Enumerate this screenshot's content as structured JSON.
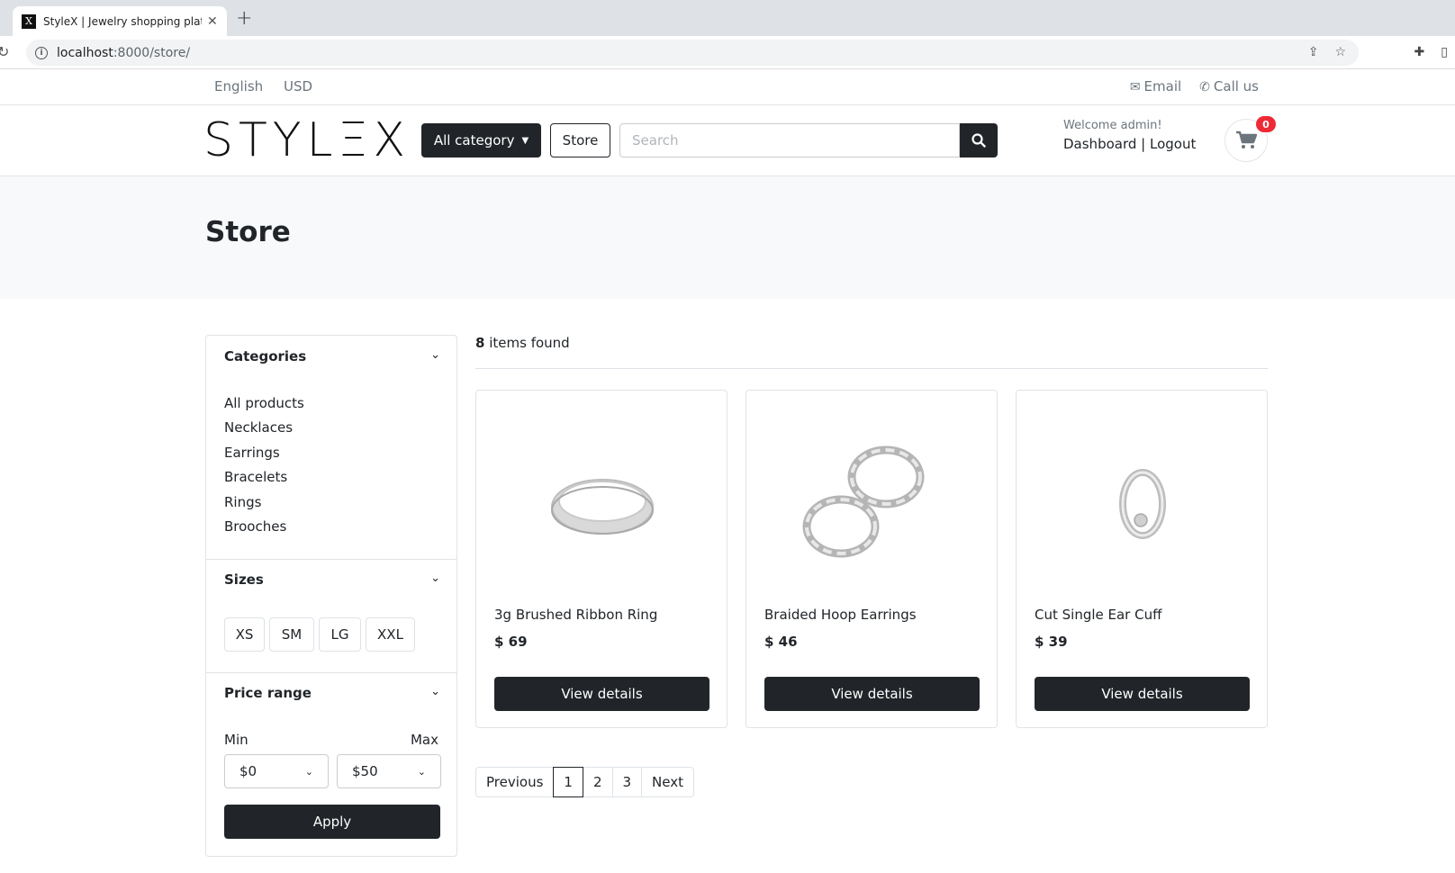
{
  "browser": {
    "tab_title": "StyleX | Jewelry shopping platf",
    "favicon_letter": "X",
    "url_host": "localhost",
    "url_rest": ":8000/store/"
  },
  "topbar": {
    "language": "English",
    "currency": "USD",
    "email_label": "Email",
    "call_label": "Call us"
  },
  "header": {
    "logo_text": "STYLΞX",
    "all_category_label": "All category",
    "store_label": "Store",
    "search_placeholder": "Search",
    "welcome_text": "Welcome admin!",
    "dashboard_label": "Dashboard",
    "separator": "|",
    "logout_label": "Logout",
    "cart_count": "0"
  },
  "page": {
    "title": "Store"
  },
  "sidebar": {
    "categories_heading": "Categories",
    "categories": [
      "All products",
      "Necklaces",
      "Earrings",
      "Bracelets",
      "Rings",
      "Brooches"
    ],
    "sizes_heading": "Sizes",
    "sizes": [
      "XS",
      "SM",
      "LG",
      "XXL"
    ],
    "price_heading": "Price range",
    "min_label": "Min",
    "max_label": "Max",
    "min_value": "$0",
    "max_value": "$50",
    "apply_label": "Apply"
  },
  "results": {
    "count": "8",
    "count_suffix": "items found"
  },
  "products": [
    {
      "name": "3g Brushed Ribbon Ring",
      "price": "$ 69",
      "button": "View details"
    },
    {
      "name": "Braided Hoop Earrings",
      "price": "$ 46",
      "button": "View details"
    },
    {
      "name": "Cut Single Ear Cuff",
      "price": "$ 39",
      "button": "View details"
    }
  ],
  "pagination": {
    "previous": "Previous",
    "pages": [
      "1",
      "2",
      "3"
    ],
    "current": "1",
    "next": "Next"
  },
  "colors": {
    "dark": "#212529",
    "badge": "#ee2a37",
    "band": "#f8f9fa"
  }
}
